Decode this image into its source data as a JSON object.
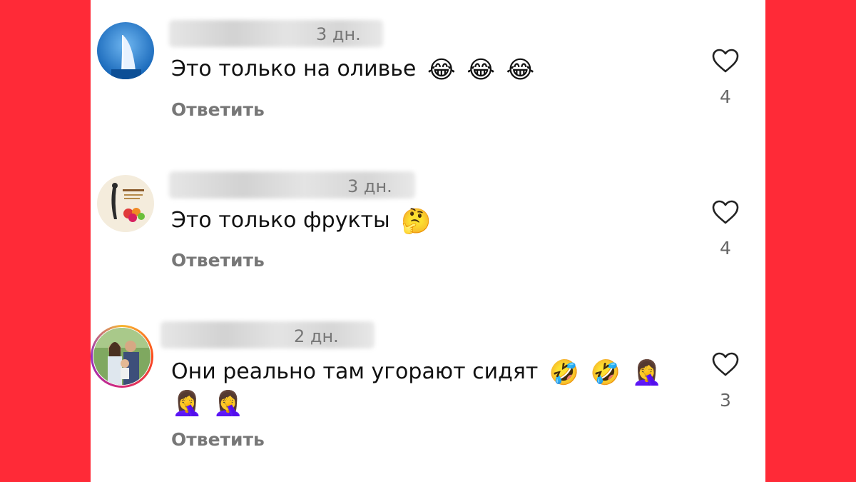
{
  "colors": {
    "background": "#ff2a37",
    "panel": "#ffffff",
    "meta_text": "#777777"
  },
  "comments": [
    {
      "username_visible": false,
      "timestamp": "3 дн.",
      "text": "Это только на оливье",
      "emoji": [
        "😂",
        "😂",
        "😂"
      ],
      "reply_label": "Ответить",
      "likes": "4",
      "avatar": "burj-al-arab-icon"
    },
    {
      "username_visible": false,
      "timestamp": "3 дн.",
      "text": "Это только фрукты",
      "emoji": [
        "🤔"
      ],
      "reply_label": "Ответить",
      "likes": "4",
      "avatar": "fruit-logo-icon"
    },
    {
      "username_visible": false,
      "timestamp": "2 дн.",
      "text": "Они реально там угорают сидят",
      "emoji": [
        "🤣",
        "🤣",
        "🤦‍♀️"
      ],
      "emoji_line2": [
        "🤦‍♀️",
        "🤦‍♀️"
      ],
      "reply_label": "Ответить",
      "likes": "3",
      "avatar": "family-photo-icon",
      "story_ring": true
    }
  ]
}
